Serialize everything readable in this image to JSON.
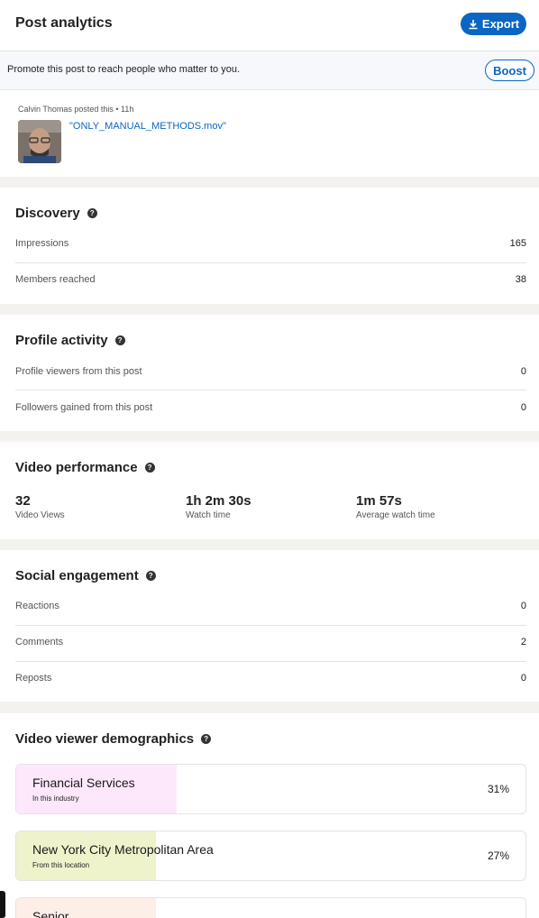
{
  "header": {
    "title": "Post analytics",
    "export_label": "Export"
  },
  "promote": {
    "text": "Promote this post to reach people who matter to you.",
    "boost_label": "Boost"
  },
  "post": {
    "meta": "Calvin Thomas posted this • 11h",
    "title": "\"ONLY_MANUAL_METHODS.mov\""
  },
  "discovery": {
    "title": "Discovery",
    "rows": [
      {
        "label": "Impressions",
        "value": "165"
      },
      {
        "label": "Members reached",
        "value": "38"
      }
    ]
  },
  "profile_activity": {
    "title": "Profile activity",
    "rows": [
      {
        "label": "Profile viewers from this post",
        "value": "0"
      },
      {
        "label": "Followers gained from this post",
        "value": "0"
      }
    ]
  },
  "video_performance": {
    "title": "Video performance",
    "stats": [
      {
        "value": "32",
        "label": "Video Views"
      },
      {
        "value": "1h 2m 30s",
        "label": "Watch time"
      },
      {
        "value": "1m 57s",
        "label": "Average watch time"
      }
    ]
  },
  "social_engagement": {
    "title": "Social engagement",
    "rows": [
      {
        "label": "Reactions",
        "value": "0"
      },
      {
        "label": "Comments",
        "value": "2"
      },
      {
        "label": "Reposts",
        "value": "0"
      }
    ]
  },
  "demographics": {
    "title": "Video viewer demographics",
    "items": [
      {
        "name": "Financial Services",
        "sub": "In this industry",
        "pct": "31%",
        "share": 0.31,
        "color": "#fde8fb"
      },
      {
        "name": "New York City Metropolitan Area",
        "sub": "From this location",
        "pct": "27%",
        "share": 0.27,
        "color": "#eef3cc"
      },
      {
        "name": "Senior",
        "sub": "",
        "pct": "",
        "share": 0.27,
        "color": "#fdeee8"
      }
    ]
  },
  "colors": {
    "accent": "#0a66c2"
  }
}
